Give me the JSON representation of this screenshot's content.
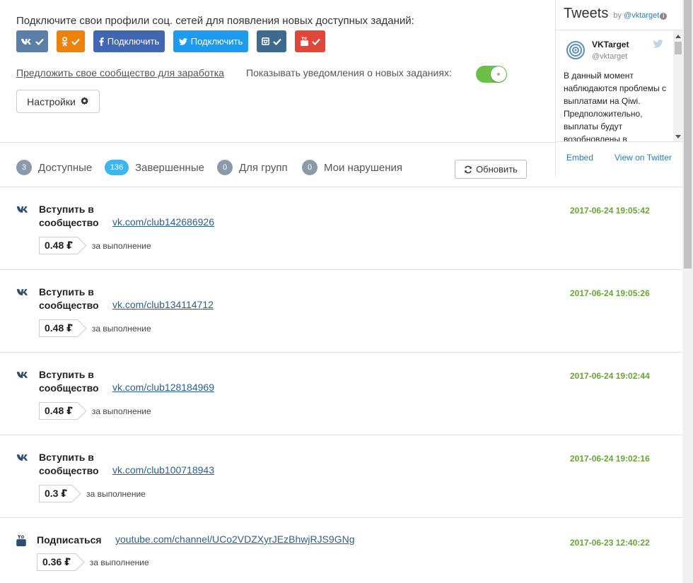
{
  "connect": {
    "title": "Подключите свои профили соц. сетей для появления новых доступных заданий:",
    "buttons": [
      {
        "network": "vk",
        "icon": "vk-icon",
        "status": "check-icon",
        "label": "",
        "color": "#5b7fa6"
      },
      {
        "network": "ok",
        "icon": "odnoklassniki-icon",
        "status": "check-icon",
        "label": "",
        "color": "#ee8208"
      },
      {
        "network": "facebook",
        "icon": "facebook-icon",
        "label": "Подключить",
        "color": "#4267b2"
      },
      {
        "network": "twitter",
        "icon": "twitter-icon",
        "label": "Подключить",
        "color": "#1d9bf0"
      },
      {
        "network": "instagram",
        "icon": "instagram-icon",
        "status": "check-icon",
        "label": "",
        "color": "#3f6a90"
      },
      {
        "network": "youtube",
        "icon": "youtube-icon",
        "status": "check-icon",
        "label": "",
        "color": "#e0463a"
      }
    ]
  },
  "options": {
    "suggest_link": "Предложить свое сообщество для заработка",
    "notify_label": "Показывать уведомления о новых заданиях:",
    "notify_enabled": true,
    "settings_label": "Настройки"
  },
  "tabs": [
    {
      "count": "3",
      "label": "Доступные",
      "active": false
    },
    {
      "count": "136",
      "label": "Завершенные",
      "active": true
    },
    {
      "count": "0",
      "label": "Для групп",
      "active": false
    },
    {
      "count": "0",
      "label": "Мои нарушения",
      "active": false
    }
  ],
  "refresh_label": "Обновить",
  "tasks": [
    {
      "network": "vk",
      "icon": "vk-icon",
      "title": "Вступить в сообщество",
      "link": "vk.com/club142686926",
      "price": "0.48 ₽",
      "price_note": "за выполнение",
      "date": "2017-06-24 19:05:42"
    },
    {
      "network": "vk",
      "icon": "vk-icon",
      "title": "Вступить в сообщество",
      "link": "vk.com/club134114712",
      "price": "0.48 ₽",
      "price_note": "за выполнение",
      "date": "2017-06-24 19:05:26"
    },
    {
      "network": "vk",
      "icon": "vk-icon",
      "title": "Вступить в сообщество",
      "link": "vk.com/club128184969",
      "price": "0.48 ₽",
      "price_note": "за выполнение",
      "date": "2017-06-24 19:02:44"
    },
    {
      "network": "vk",
      "icon": "vk-icon",
      "title": "Вступить в сообщество",
      "link": "vk.com/club100718943",
      "price": "0.3 ₽",
      "price_note": "за выполнение",
      "date": "2017-06-24 19:02:16"
    },
    {
      "network": "youtube",
      "icon": "youtube-icon",
      "title": "Подписаться",
      "link": "youtube.com/channel/UCo2VDZXyrJEzBhwjRJS9GNg",
      "price": "0.36 ₽",
      "price_note": "за выполнение",
      "date": "2017-06-23 12:40:22"
    }
  ],
  "twitter": {
    "title": "Tweets",
    "by_prefix": "by",
    "by_handle": "@vktarget",
    "tweet_name": "VKTarget",
    "tweet_handle": "@vktarget",
    "tweet_text": "В данный момент наблюдаются проблемы с выплатами на Qiwi. Предположительно, выплаты будут возобновлены в",
    "embed": "Embed",
    "view": "View on Twitter"
  },
  "colors": {
    "accent": "#3fb5ef",
    "date": "#6aa43a",
    "toggle_on": "#6cc04a",
    "link": "#2b5f8f"
  }
}
